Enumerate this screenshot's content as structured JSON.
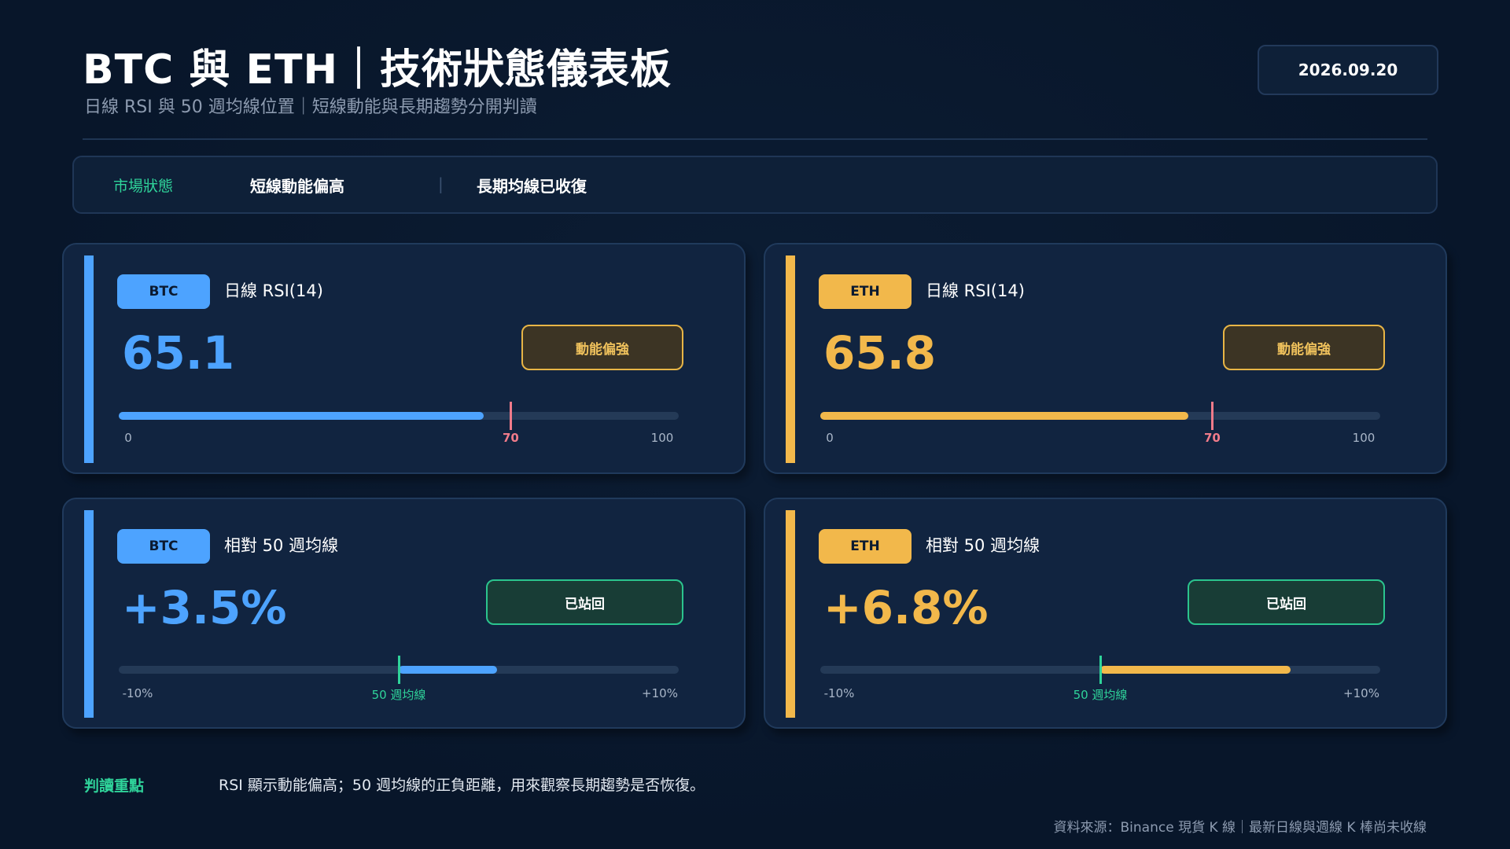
{
  "header": {
    "title": "BTC 與 ETH｜技術狀態儀表板",
    "subtitle": "日線 RSI 與 50 週均線位置｜短線動能與長期趨勢分開判讀",
    "date": "2026.09.20"
  },
  "status": {
    "label": "市場狀態",
    "item1": "短線動能偏高",
    "separator": "|",
    "item2": "長期均線已收復"
  },
  "colors": {
    "btc": "#4da3ff",
    "eth": "#f2b84b",
    "rsi_marker": "#f07b8a",
    "ma_marker": "#2fd39a",
    "positive": "#2fd39a"
  },
  "cards": {
    "btc_rsi": {
      "tag": "BTC",
      "title": "日線 RSI(14)",
      "value": "65.1",
      "badge": "動能偏強",
      "progress": 0.651,
      "marker_value": 0.7,
      "ticks": [
        "0",
        "70",
        "100"
      ]
    },
    "eth_rsi": {
      "tag": "ETH",
      "title": "日線 RSI(14)",
      "value": "65.8",
      "badge": "動能偏強",
      "progress": 0.658,
      "marker_value": 0.7,
      "ticks": [
        "0",
        "70",
        "100"
      ]
    },
    "btc_ma": {
      "tag": "BTC",
      "title": "相對 50 週均線",
      "value": "+3.5%",
      "badge": "已站回",
      "deviation_pct": 3.5,
      "range_pct": [
        -10,
        10
      ],
      "ticks": [
        "-10%",
        "50 週均線",
        "+10%"
      ]
    },
    "eth_ma": {
      "tag": "ETH",
      "title": "相對 50 週均線",
      "value": "+6.8%",
      "badge": "已站回",
      "deviation_pct": 6.8,
      "range_pct": [
        -10,
        10
      ],
      "ticks": [
        "-10%",
        "50 週均線",
        "+10%"
      ]
    }
  },
  "footer": {
    "insight_label": "判讀重點",
    "insight_text": "RSI 顯示動能偏高；50 週均線的正負距離，用來觀察長期趨勢是否恢復。",
    "source": "資料來源：Binance 現貨 K 線｜最新日線與週線 K 棒尚未收線"
  }
}
